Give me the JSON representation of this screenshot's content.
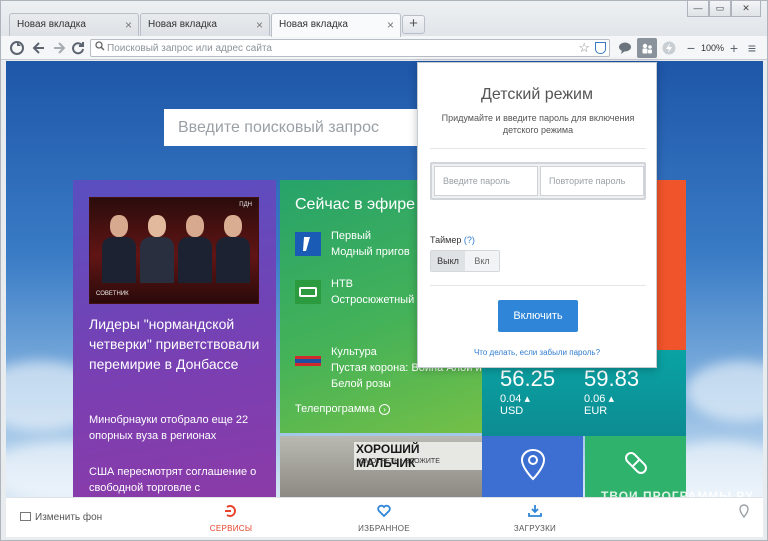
{
  "tabs": [
    {
      "label": "Новая вкладка",
      "active": false
    },
    {
      "label": "Новая вкладка",
      "active": false
    },
    {
      "label": "Новая вкладка",
      "active": true
    }
  ],
  "tab_close_glyph": "×",
  "new_tab_glyph": "+",
  "window_controls": {
    "minimize": "—",
    "maximize": "▭",
    "close": "✕"
  },
  "toolbar": {
    "address_placeholder": "Поисковый запрос или адрес сайта",
    "zoom": "100%",
    "zoom_out": "−",
    "zoom_in": "+",
    "menu": "≡",
    "icons": [
      "logo-icon",
      "back-icon",
      "forward-icon",
      "reload-icon",
      "search-icon",
      "star-icon",
      "shield-icon",
      "chat-icon",
      "kids-mode-icon",
      "speed-icon"
    ]
  },
  "search": {
    "placeholder": "Введите поисковый запрос"
  },
  "news": {
    "photo_caption": "СОВЕТНИК",
    "photo_logo": "ПДН",
    "headline": "Лидеры \"нормандской четверки\" приветствовали перемирие в Донбассе",
    "items": [
      "Минобрнауки отобрало еще 22 опорных вуза в регионах",
      "США пересмотрят соглашение о свободной торговле с"
    ]
  },
  "tv": {
    "title": "Сейчас в эфире",
    "channels": [
      {
        "name": "Первый",
        "show": "Модный пригов",
        "logo_color": "#1a5bb5"
      },
      {
        "name": "НТВ",
        "show": "Остросюжетный \"Лесник\"",
        "logo_color": "#2c9a3e"
      },
      {
        "name": "Культура",
        "show": "Пустая корона: Война Алой и Белой розы",
        "logo_color": "#d02b2b"
      }
    ],
    "link": "Телепрограмма"
  },
  "show_banner": {
    "title": "ХОРОШИЙ МАЛЬЧИК",
    "subtitle": "СМОТРЕТЬ - ВЛОЖИТЕ"
  },
  "currency": [
    {
      "rate": "56.25",
      "delta": "0.04",
      "code": "USD"
    },
    {
      "rate": "59.83",
      "delta": "0.06",
      "code": "EUR"
    }
  ],
  "currency_arrow": "▴",
  "popup": {
    "title": "Детский режим",
    "description": "Придумайте и введите пароль для включения детского режима",
    "password_placeholder": "Введите пароль",
    "repeat_placeholder": "Повторите пароль",
    "timer_label": "Таймер",
    "timer_help": "(?)",
    "timer_off": "Выкл",
    "timer_on": "Вкл",
    "enable_button": "Включить",
    "forgot_link": "Что делать, если забыли пароль?"
  },
  "bottom": {
    "change_bg": "Изменить фон",
    "services": "СЕРВИСЫ",
    "favorites": "ИЗБРАННОЕ",
    "downloads": "ЗАГРУЗКИ"
  },
  "watermark": "ТВОИ ПРОГРАММЫ РУ",
  "colors": {
    "accent": "#2f86d8",
    "services": "#e8432b",
    "favorites": "#2f86d8",
    "downloads": "#2f86d8"
  }
}
